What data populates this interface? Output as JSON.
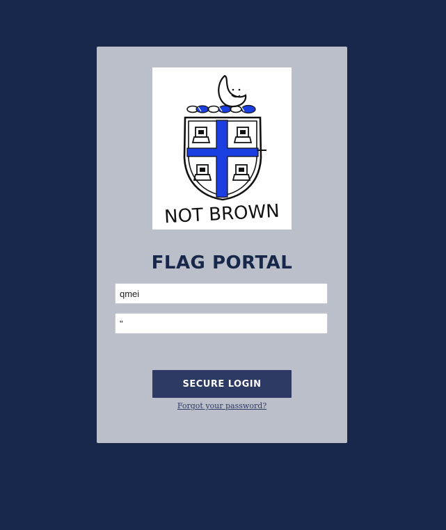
{
  "page": {
    "background_color": "#18284a"
  },
  "card": {
    "background_color": "#bbbfca"
  },
  "logo": {
    "icon": "not-brown-crest-logo",
    "caption": "NOT BROWN",
    "accent_color": "#1b3ee0"
  },
  "login": {
    "title": "FLAG PORTAL",
    "username_value": "qmei",
    "password_value": "\"",
    "submit_label": "SECURE LOGIN",
    "submit_color": "#2d3a63",
    "forgot_label": "Forgot your password?"
  }
}
